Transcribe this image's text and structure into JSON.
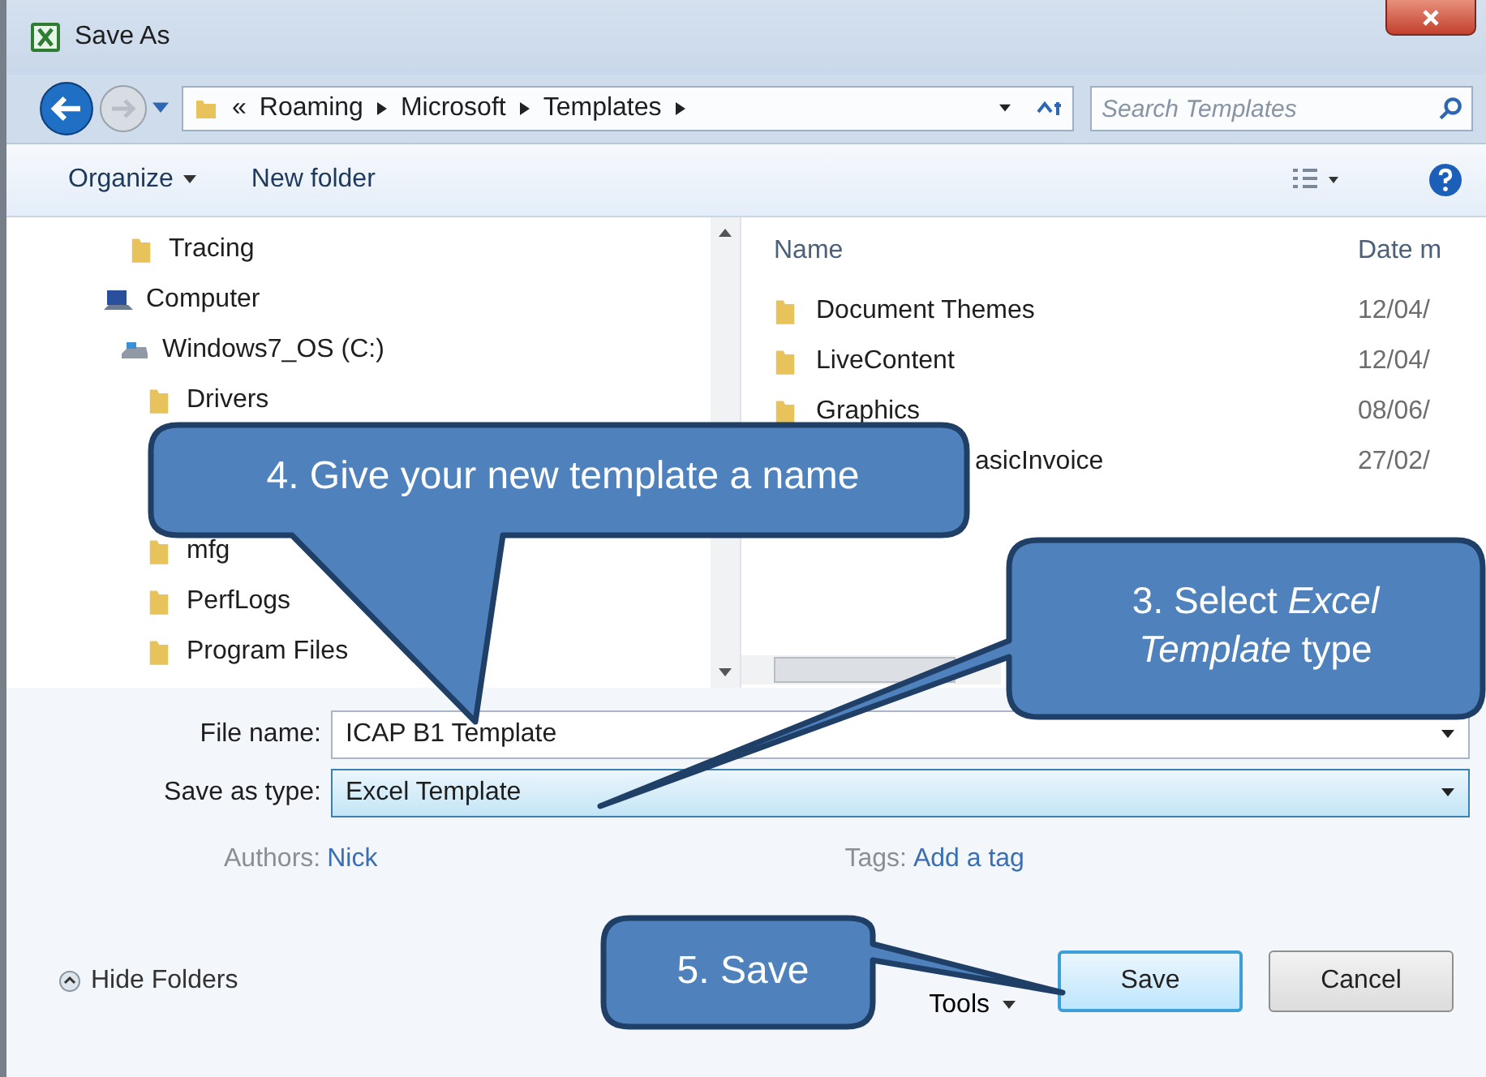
{
  "window": {
    "title": "Save As"
  },
  "address": {
    "overflow": "«",
    "path": [
      "Roaming",
      "Microsoft",
      "Templates"
    ]
  },
  "search": {
    "placeholder": "Search Templates"
  },
  "toolbar": [
    {
      "label": "Organize",
      "dropdown": true
    },
    {
      "label": "New folder",
      "dropdown": false
    }
  ],
  "tree": [
    {
      "label": "Tracing",
      "kind": "folder"
    },
    {
      "label": "Computer",
      "kind": "computer",
      "children": [
        {
          "label": "Windows7_OS (C:)",
          "kind": "drive",
          "children": [
            {
              "label": "Drivers",
              "kind": "folder"
            },
            {
              "kind": "folder",
              "covered": true
            },
            {
              "kind": "folder",
              "covered": true
            },
            {
              "label": "mfg",
              "kind": "folder"
            },
            {
              "label": "PerfLogs",
              "kind": "folder"
            },
            {
              "label": "Program Files",
              "kind": "folder"
            }
          ]
        }
      ]
    }
  ],
  "files": {
    "columns": [
      "Name",
      "Date m"
    ],
    "rows": [
      {
        "name": "Document Themes",
        "date": "12/04/",
        "covered": false
      },
      {
        "name": "LiveContent",
        "date": "12/04/",
        "covered": false
      },
      {
        "name": "Graphics",
        "date": "08/06/",
        "covered": false
      },
      {
        "name": "asicInvoice",
        "date": "27/02/",
        "covered": true
      }
    ]
  },
  "form": [
    {
      "label": "File name:",
      "value": "ICAP B1 Template",
      "focused": false
    },
    {
      "label": "Save as type:",
      "value": "Excel Template",
      "focused": true
    }
  ],
  "meta": [
    {
      "label": "Authors:",
      "value": "Nick"
    },
    {
      "label": "Tags:",
      "value": "Add a tag"
    }
  ],
  "footer": {
    "hide_folders": "Hide Folders",
    "tools": "Tools",
    "buttons": [
      {
        "label": "Save",
        "default": true
      },
      {
        "label": "Cancel",
        "default": false
      }
    ]
  },
  "callouts": [
    "4. Give your new template a name",
    "3. Select *Excel Template* type",
    "5. Save"
  ]
}
